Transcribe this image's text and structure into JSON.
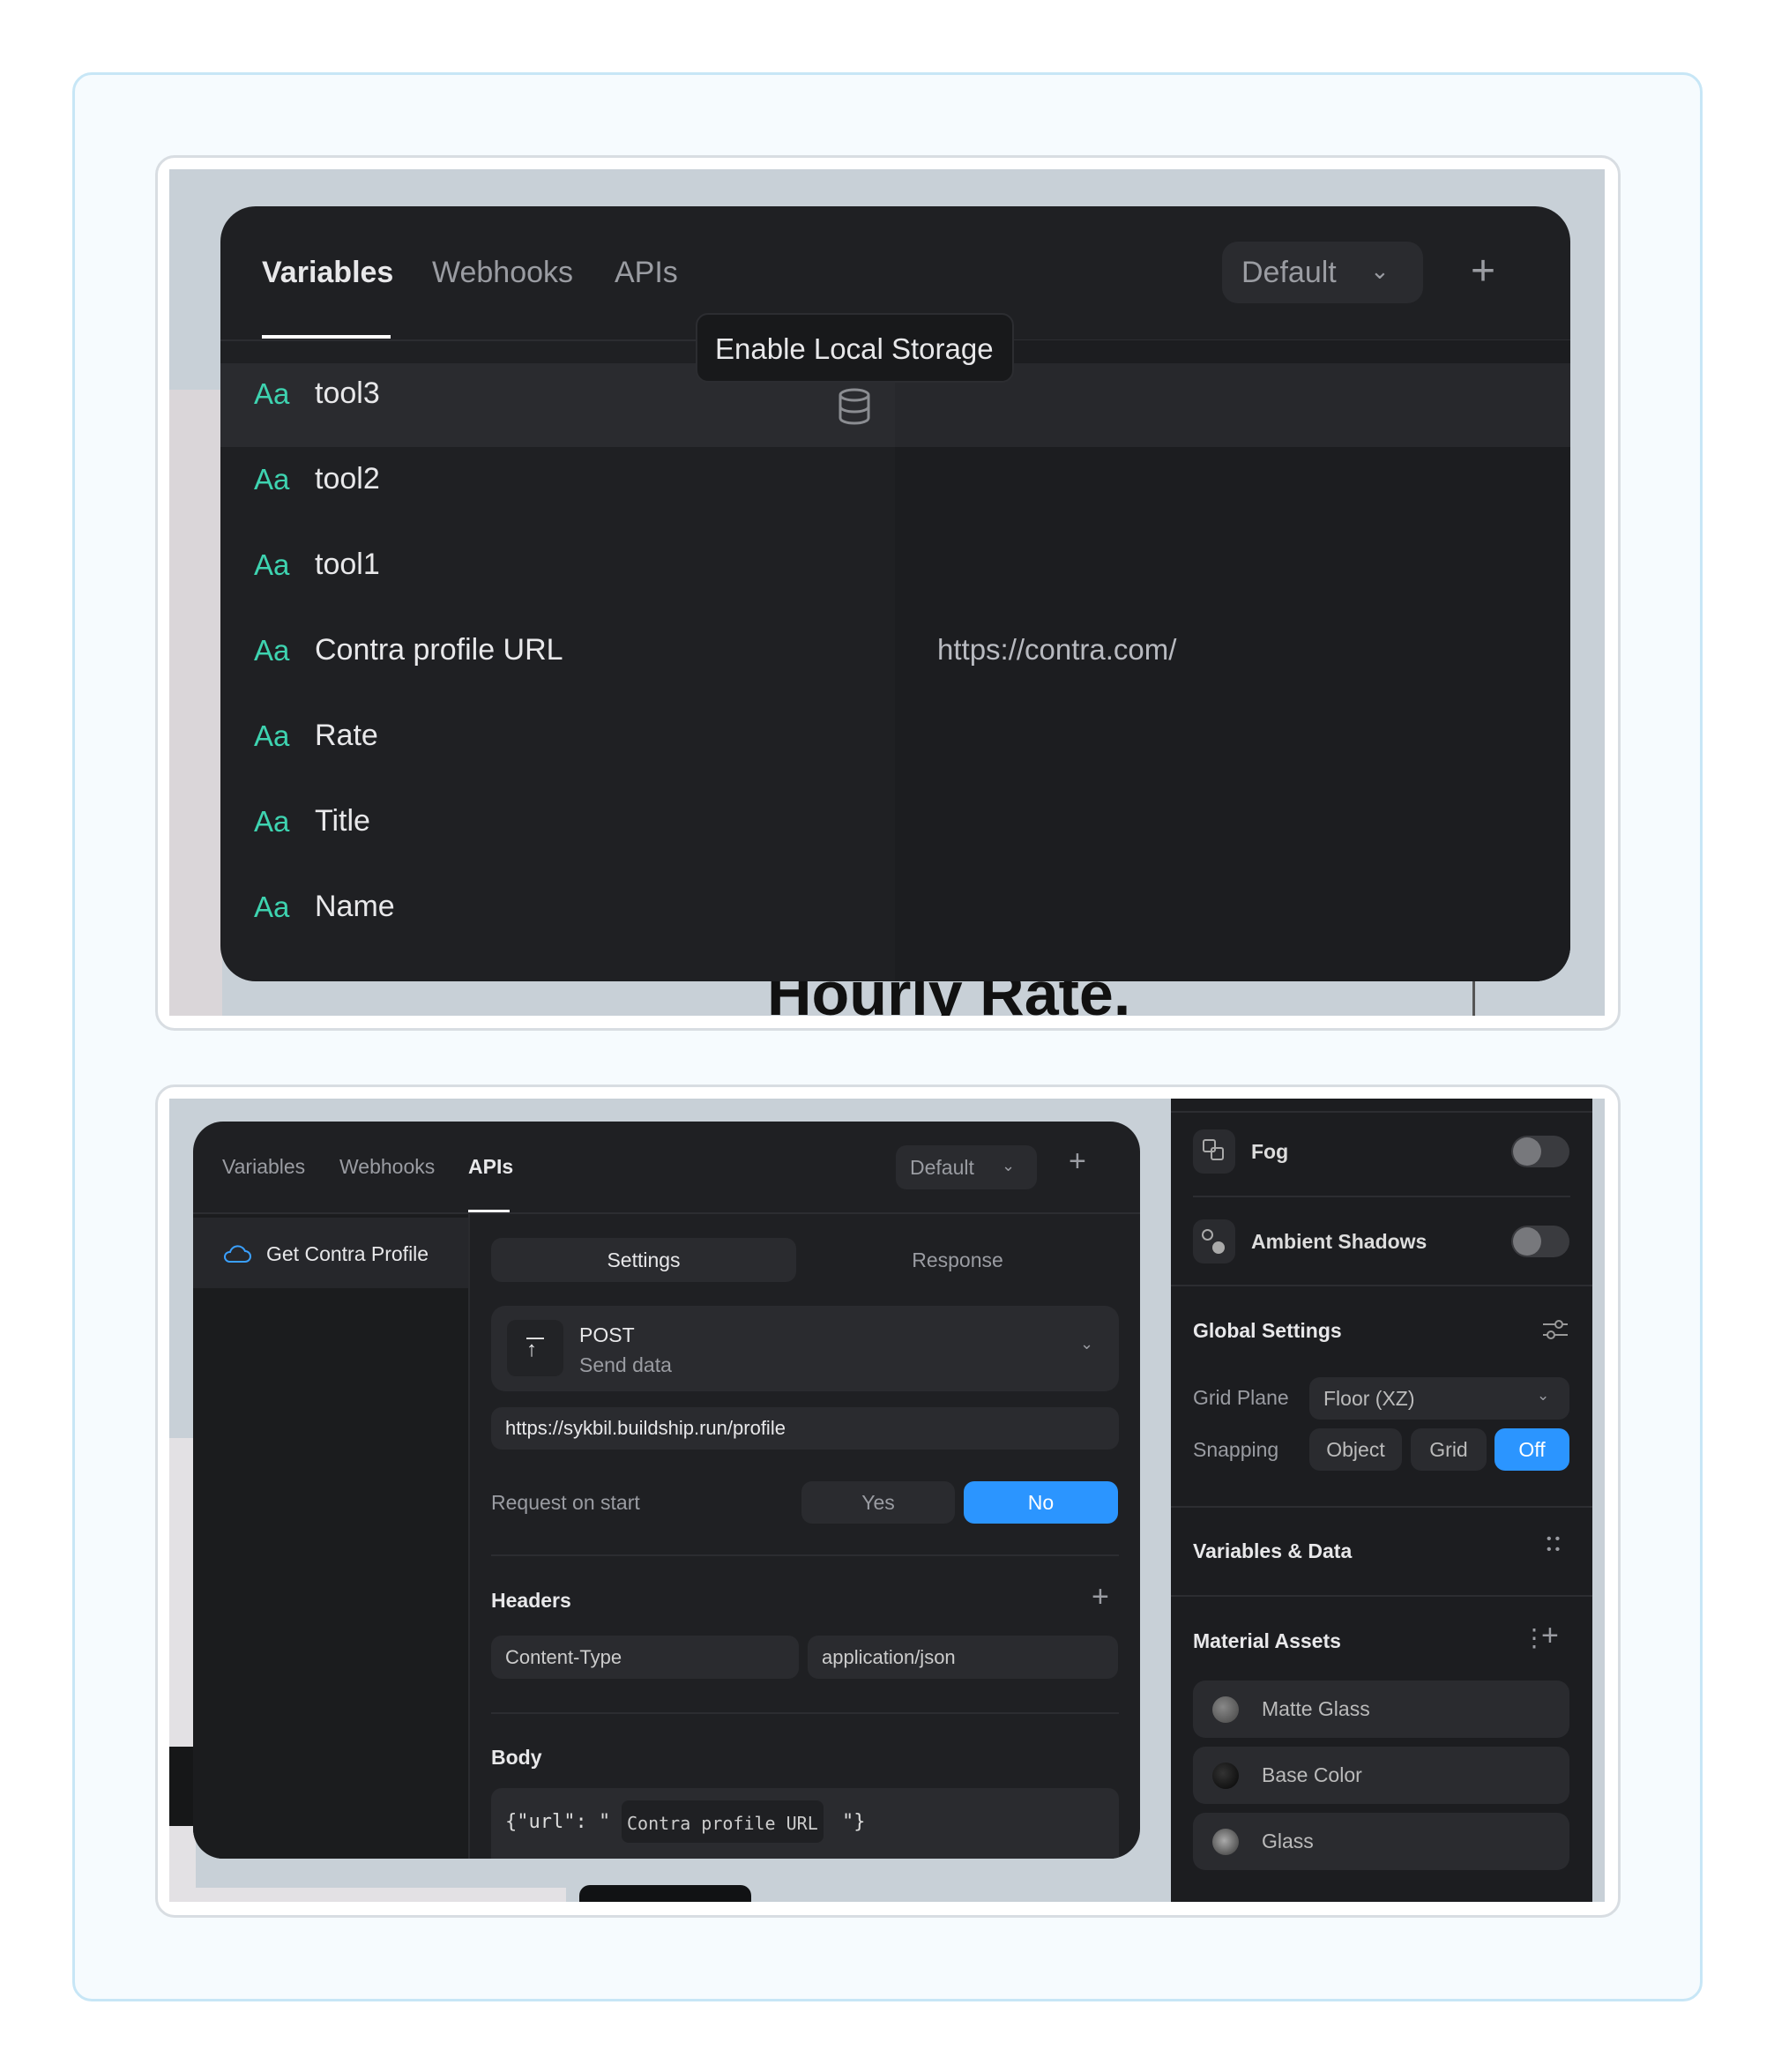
{
  "top": {
    "tabs": [
      {
        "label": "Variables",
        "active": true
      },
      {
        "label": "Webhooks"
      },
      {
        "label": "APIs"
      }
    ],
    "env_dropdown": "Default",
    "tooltip": "Enable Local Storage",
    "type_icon": "Aa",
    "variables": [
      {
        "name": "tool3",
        "value": ""
      },
      {
        "name": "tool2",
        "value": ""
      },
      {
        "name": "tool1",
        "value": ""
      },
      {
        "name": "Contra profile URL",
        "value": "https://contra.com/"
      },
      {
        "name": "Rate",
        "value": ""
      },
      {
        "name": "Title",
        "value": ""
      },
      {
        "name": "Name",
        "value": ""
      }
    ],
    "background_text": "Hourly Rate."
  },
  "bottom": {
    "tabs": [
      {
        "label": "Variables"
      },
      {
        "label": "Webhooks"
      },
      {
        "label": "APIs",
        "active": true
      }
    ],
    "env_dropdown": "Default",
    "sidebar_item": "Get Contra Profile",
    "subtabs": [
      {
        "label": "Settings",
        "active": true
      },
      {
        "label": "Response"
      }
    ],
    "method": {
      "name": "POST",
      "description": "Send data"
    },
    "url": "https://sykbil.buildship.run/profile",
    "request_on_start": {
      "label": "Request on start",
      "options": [
        "Yes",
        "No"
      ],
      "selected": "No"
    },
    "headers": {
      "title": "Headers",
      "key": "Content-Type",
      "value": "application/json"
    },
    "body": {
      "title": "Body",
      "prefix": "{\"url\": \"",
      "variable": "Contra profile URL",
      "suffix": "\"}"
    }
  },
  "right_panel": {
    "fog": {
      "label": "Fog",
      "enabled": false
    },
    "ambient_shadows": {
      "label": "Ambient Shadows",
      "enabled": false
    },
    "global_settings": {
      "title": "Global Settings",
      "grid_plane_label": "Grid Plane",
      "grid_plane_value": "Floor (XZ)",
      "snapping_label": "Snapping",
      "snapping_options": [
        "Object",
        "Grid",
        "Off"
      ],
      "snapping_selected": "Off"
    },
    "variables_data": "Variables & Data",
    "material_assets": {
      "title": "Material Assets",
      "items": [
        "Matte Glass",
        "Base Color",
        "Glass"
      ]
    }
  },
  "colors": {
    "accent": "#2b95ff",
    "type_icon": "#3ed3b0",
    "panel": "#1f2023"
  }
}
